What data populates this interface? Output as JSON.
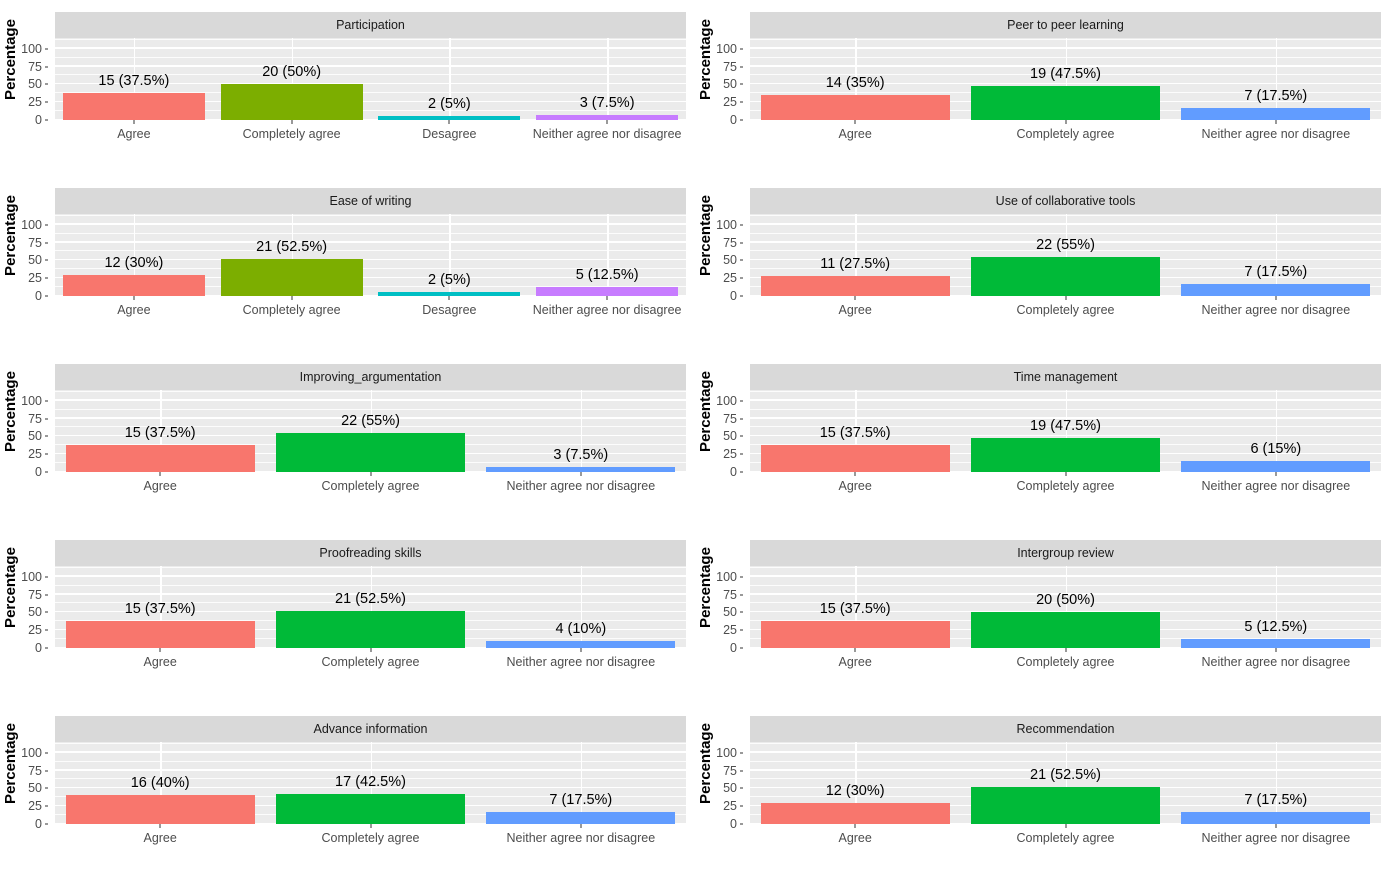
{
  "figure": {
    "axis_y_title": "Percentage",
    "y_ticks": [
      "0",
      "25",
      "50",
      "75",
      "100"
    ],
    "y_tick_values": [
      0,
      25,
      50,
      75,
      100
    ],
    "y_limit": [
      0,
      115
    ],
    "background": "#FFFFFF",
    "panel_background": "#EBEBEB",
    "strip_background": "#D9D9D9",
    "gridline_color": "#FFFFFF",
    "palette": {
      "red": "#F8766D",
      "olive": "#7CAE00",
      "green": "#00BA38",
      "cyan": "#00BFC4",
      "blue": "#619CFF",
      "purple": "#C77CFF"
    }
  },
  "chart_data": {
    "type": "bar",
    "title": "",
    "xlabel": "",
    "ylabel": "Percentage",
    "ylim": [
      0,
      115
    ],
    "grid": true,
    "legend": "none",
    "layout": "facet grid 5 rows x 2 columns",
    "panels": [
      {
        "title": "Participation",
        "categories": [
          "Agree",
          "Completely agree",
          "Desagree",
          "Neither agree nor disagree"
        ],
        "values": [
          37.5,
          50,
          5,
          7.5
        ],
        "counts": [
          15,
          20,
          2,
          3
        ],
        "labels": [
          "15 (37.5%)",
          "20 (50%)",
          "2 (5%)",
          "3 (7.5%)"
        ],
        "colors": [
          "#F8766D",
          "#7CAE00",
          "#00BFC4",
          "#C77CFF"
        ]
      },
      {
        "title": "Peer to peer learning",
        "categories": [
          "Agree",
          "Completely agree",
          "Neither agree nor disagree"
        ],
        "values": [
          35,
          47.5,
          17.5
        ],
        "counts": [
          14,
          19,
          7
        ],
        "labels": [
          "14 (35%)",
          "19 (47.5%)",
          "7 (17.5%)"
        ],
        "colors": [
          "#F8766D",
          "#00BA38",
          "#619CFF"
        ]
      },
      {
        "title": "Ease of writing",
        "categories": [
          "Agree",
          "Completely agree",
          "Desagree",
          "Neither agree nor disagree"
        ],
        "values": [
          30,
          52.5,
          5,
          12.5
        ],
        "counts": [
          12,
          21,
          2,
          5
        ],
        "labels": [
          "12 (30%)",
          "21 (52.5%)",
          "2 (5%)",
          "5 (12.5%)"
        ],
        "colors": [
          "#F8766D",
          "#7CAE00",
          "#00BFC4",
          "#C77CFF"
        ]
      },
      {
        "title": "Use of collaborative tools",
        "categories": [
          "Agree",
          "Completely agree",
          "Neither agree nor disagree"
        ],
        "values": [
          27.5,
          55,
          17.5
        ],
        "counts": [
          11,
          22,
          7
        ],
        "labels": [
          "11 (27.5%)",
          "22 (55%)",
          "7 (17.5%)"
        ],
        "colors": [
          "#F8766D",
          "#00BA38",
          "#619CFF"
        ]
      },
      {
        "title": "Improving_argumentation",
        "categories": [
          "Agree",
          "Completely agree",
          "Neither agree nor disagree"
        ],
        "values": [
          37.5,
          55,
          7.5
        ],
        "counts": [
          15,
          22,
          3
        ],
        "labels": [
          "15 (37.5%)",
          "22 (55%)",
          "3 (7.5%)"
        ],
        "colors": [
          "#F8766D",
          "#00BA38",
          "#619CFF"
        ]
      },
      {
        "title": "Time management",
        "categories": [
          "Agree",
          "Completely agree",
          "Neither agree nor disagree"
        ],
        "values": [
          37.5,
          47.5,
          15
        ],
        "counts": [
          15,
          19,
          6
        ],
        "labels": [
          "15 (37.5%)",
          "19 (47.5%)",
          "6 (15%)"
        ],
        "colors": [
          "#F8766D",
          "#00BA38",
          "#619CFF"
        ]
      },
      {
        "title": "Proofreading skills",
        "categories": [
          "Agree",
          "Completely agree",
          "Neither agree nor disagree"
        ],
        "values": [
          37.5,
          52.5,
          10
        ],
        "counts": [
          15,
          21,
          4
        ],
        "labels": [
          "15 (37.5%)",
          "21 (52.5%)",
          "4 (10%)"
        ],
        "colors": [
          "#F8766D",
          "#00BA38",
          "#619CFF"
        ]
      },
      {
        "title": "Intergroup review",
        "categories": [
          "Agree",
          "Completely agree",
          "Neither agree nor disagree"
        ],
        "values": [
          37.5,
          50,
          12.5
        ],
        "counts": [
          15,
          20,
          5
        ],
        "labels": [
          "15 (37.5%)",
          "20 (50%)",
          "5 (12.5%)"
        ],
        "colors": [
          "#F8766D",
          "#00BA38",
          "#619CFF"
        ]
      },
      {
        "title": "Advance information",
        "categories": [
          "Agree",
          "Completely agree",
          "Neither agree nor disagree"
        ],
        "values": [
          40,
          42.5,
          17.5
        ],
        "counts": [
          16,
          17,
          7
        ],
        "labels": [
          "16 (40%)",
          "17 (42.5%)",
          "7 (17.5%)"
        ],
        "colors": [
          "#F8766D",
          "#00BA38",
          "#619CFF"
        ]
      },
      {
        "title": "Recommendation",
        "categories": [
          "Agree",
          "Completely agree",
          "Neither agree nor disagree"
        ],
        "values": [
          30,
          52.5,
          17.5
        ],
        "counts": [
          12,
          21,
          7
        ],
        "labels": [
          "12 (30%)",
          "21 (52.5%)",
          "7 (17.5%)"
        ],
        "colors": [
          "#F8766D",
          "#00BA38",
          "#619CFF"
        ]
      }
    ]
  }
}
